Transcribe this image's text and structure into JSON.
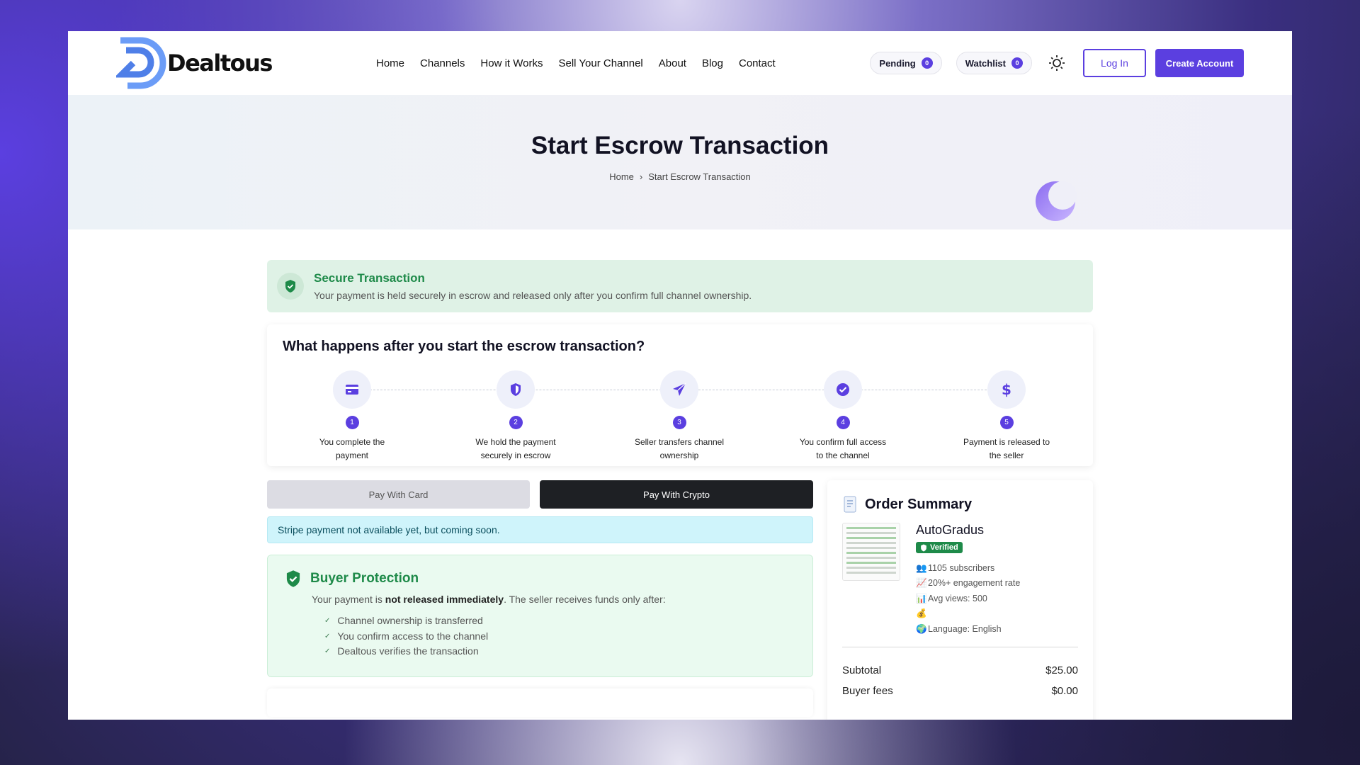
{
  "brand": {
    "name": "Dealtous",
    "accent": "#5b3fe0"
  },
  "nav": [
    "Home",
    "Channels",
    "How it Works",
    "Sell Your Channel",
    "About",
    "Blog",
    "Contact"
  ],
  "header": {
    "pending_label": "Pending",
    "pending_count": "0",
    "watchlist_label": "Watchlist",
    "watchlist_count": "0",
    "login": "Log In",
    "create": "Create Account"
  },
  "hero": {
    "title": "Start Escrow Transaction",
    "breadcrumb": [
      "Home",
      "Start Escrow Transaction"
    ]
  },
  "secure": {
    "title": "Secure Transaction",
    "text": "Your payment is held securely in escrow and released only after you confirm full channel ownership."
  },
  "steps": {
    "title": "What happens after you start the escrow transaction?",
    "items": [
      {
        "num": "1",
        "icon": "credit-card-icon",
        "text": "You complete the payment"
      },
      {
        "num": "2",
        "icon": "shield-icon",
        "text": "We hold the payment securely in escrow"
      },
      {
        "num": "3",
        "icon": "send-icon",
        "text": "Seller transfers channel ownership"
      },
      {
        "num": "4",
        "icon": "check-circle-icon",
        "text": "You confirm full access to the channel"
      },
      {
        "num": "5",
        "icon": "dollar-icon",
        "text": "Payment is released to the seller"
      }
    ]
  },
  "payment": {
    "card_tab": "Pay With Card",
    "crypto_tab": "Pay With Crypto",
    "stripe_note": "Stripe payment not available yet, but coming soon."
  },
  "buyer_protection": {
    "title": "Buyer Protection",
    "text_before": "Your payment is ",
    "text_bold": "not released immediately",
    "text_after": ". The seller receives funds only after:",
    "items": [
      "Channel ownership is transferred",
      "You confirm access to the channel",
      "Dealtous verifies the transaction"
    ]
  },
  "order": {
    "title": "Order Summary",
    "product": "AutoGradus",
    "verified": "Verified",
    "meta": [
      {
        "icon": "👥",
        "text": "1105 subscribers"
      },
      {
        "icon": "📈",
        "text": "20%+ engagement rate"
      },
      {
        "icon": "📊",
        "text": "Avg views: 500"
      },
      {
        "icon": "💰",
        "text": ""
      },
      {
        "icon": "🌍",
        "text": "Language: English"
      }
    ],
    "rows": [
      {
        "label": "Subtotal",
        "value": "$25.00"
      },
      {
        "label": "Buyer fees",
        "value": "$0.00"
      }
    ]
  }
}
